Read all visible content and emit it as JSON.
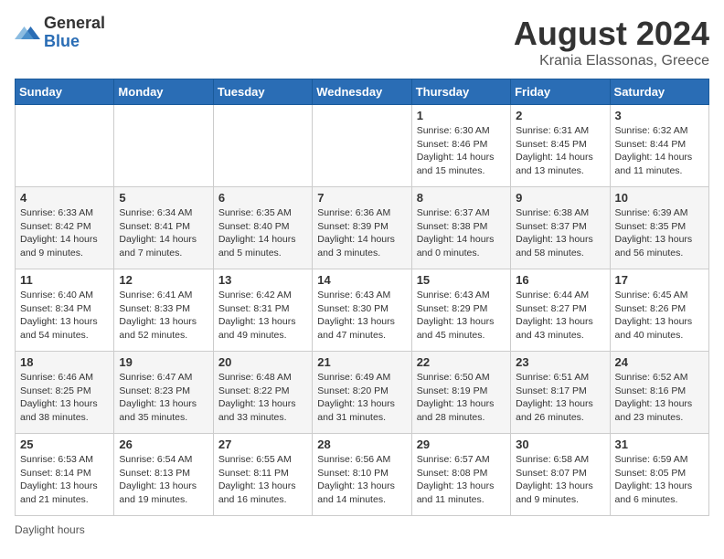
{
  "header": {
    "logo_general": "General",
    "logo_blue": "Blue",
    "month_year": "August 2024",
    "location": "Krania Elassonas, Greece"
  },
  "footer": {
    "daylight_label": "Daylight hours"
  },
  "weekdays": [
    "Sunday",
    "Monday",
    "Tuesday",
    "Wednesday",
    "Thursday",
    "Friday",
    "Saturday"
  ],
  "weeks": [
    [
      {
        "day": "",
        "info": ""
      },
      {
        "day": "",
        "info": ""
      },
      {
        "day": "",
        "info": ""
      },
      {
        "day": "",
        "info": ""
      },
      {
        "day": "1",
        "info": "Sunrise: 6:30 AM\nSunset: 8:46 PM\nDaylight: 14 hours and 15 minutes."
      },
      {
        "day": "2",
        "info": "Sunrise: 6:31 AM\nSunset: 8:45 PM\nDaylight: 14 hours and 13 minutes."
      },
      {
        "day": "3",
        "info": "Sunrise: 6:32 AM\nSunset: 8:44 PM\nDaylight: 14 hours and 11 minutes."
      }
    ],
    [
      {
        "day": "4",
        "info": "Sunrise: 6:33 AM\nSunset: 8:42 PM\nDaylight: 14 hours and 9 minutes."
      },
      {
        "day": "5",
        "info": "Sunrise: 6:34 AM\nSunset: 8:41 PM\nDaylight: 14 hours and 7 minutes."
      },
      {
        "day": "6",
        "info": "Sunrise: 6:35 AM\nSunset: 8:40 PM\nDaylight: 14 hours and 5 minutes."
      },
      {
        "day": "7",
        "info": "Sunrise: 6:36 AM\nSunset: 8:39 PM\nDaylight: 14 hours and 3 minutes."
      },
      {
        "day": "8",
        "info": "Sunrise: 6:37 AM\nSunset: 8:38 PM\nDaylight: 14 hours and 0 minutes."
      },
      {
        "day": "9",
        "info": "Sunrise: 6:38 AM\nSunset: 8:37 PM\nDaylight: 13 hours and 58 minutes."
      },
      {
        "day": "10",
        "info": "Sunrise: 6:39 AM\nSunset: 8:35 PM\nDaylight: 13 hours and 56 minutes."
      }
    ],
    [
      {
        "day": "11",
        "info": "Sunrise: 6:40 AM\nSunset: 8:34 PM\nDaylight: 13 hours and 54 minutes."
      },
      {
        "day": "12",
        "info": "Sunrise: 6:41 AM\nSunset: 8:33 PM\nDaylight: 13 hours and 52 minutes."
      },
      {
        "day": "13",
        "info": "Sunrise: 6:42 AM\nSunset: 8:31 PM\nDaylight: 13 hours and 49 minutes."
      },
      {
        "day": "14",
        "info": "Sunrise: 6:43 AM\nSunset: 8:30 PM\nDaylight: 13 hours and 47 minutes."
      },
      {
        "day": "15",
        "info": "Sunrise: 6:43 AM\nSunset: 8:29 PM\nDaylight: 13 hours and 45 minutes."
      },
      {
        "day": "16",
        "info": "Sunrise: 6:44 AM\nSunset: 8:27 PM\nDaylight: 13 hours and 43 minutes."
      },
      {
        "day": "17",
        "info": "Sunrise: 6:45 AM\nSunset: 8:26 PM\nDaylight: 13 hours and 40 minutes."
      }
    ],
    [
      {
        "day": "18",
        "info": "Sunrise: 6:46 AM\nSunset: 8:25 PM\nDaylight: 13 hours and 38 minutes."
      },
      {
        "day": "19",
        "info": "Sunrise: 6:47 AM\nSunset: 8:23 PM\nDaylight: 13 hours and 35 minutes."
      },
      {
        "day": "20",
        "info": "Sunrise: 6:48 AM\nSunset: 8:22 PM\nDaylight: 13 hours and 33 minutes."
      },
      {
        "day": "21",
        "info": "Sunrise: 6:49 AM\nSunset: 8:20 PM\nDaylight: 13 hours and 31 minutes."
      },
      {
        "day": "22",
        "info": "Sunrise: 6:50 AM\nSunset: 8:19 PM\nDaylight: 13 hours and 28 minutes."
      },
      {
        "day": "23",
        "info": "Sunrise: 6:51 AM\nSunset: 8:17 PM\nDaylight: 13 hours and 26 minutes."
      },
      {
        "day": "24",
        "info": "Sunrise: 6:52 AM\nSunset: 8:16 PM\nDaylight: 13 hours and 23 minutes."
      }
    ],
    [
      {
        "day": "25",
        "info": "Sunrise: 6:53 AM\nSunset: 8:14 PM\nDaylight: 13 hours and 21 minutes."
      },
      {
        "day": "26",
        "info": "Sunrise: 6:54 AM\nSunset: 8:13 PM\nDaylight: 13 hours and 19 minutes."
      },
      {
        "day": "27",
        "info": "Sunrise: 6:55 AM\nSunset: 8:11 PM\nDaylight: 13 hours and 16 minutes."
      },
      {
        "day": "28",
        "info": "Sunrise: 6:56 AM\nSunset: 8:10 PM\nDaylight: 13 hours and 14 minutes."
      },
      {
        "day": "29",
        "info": "Sunrise: 6:57 AM\nSunset: 8:08 PM\nDaylight: 13 hours and 11 minutes."
      },
      {
        "day": "30",
        "info": "Sunrise: 6:58 AM\nSunset: 8:07 PM\nDaylight: 13 hours and 9 minutes."
      },
      {
        "day": "31",
        "info": "Sunrise: 6:59 AM\nSunset: 8:05 PM\nDaylight: 13 hours and 6 minutes."
      }
    ]
  ]
}
